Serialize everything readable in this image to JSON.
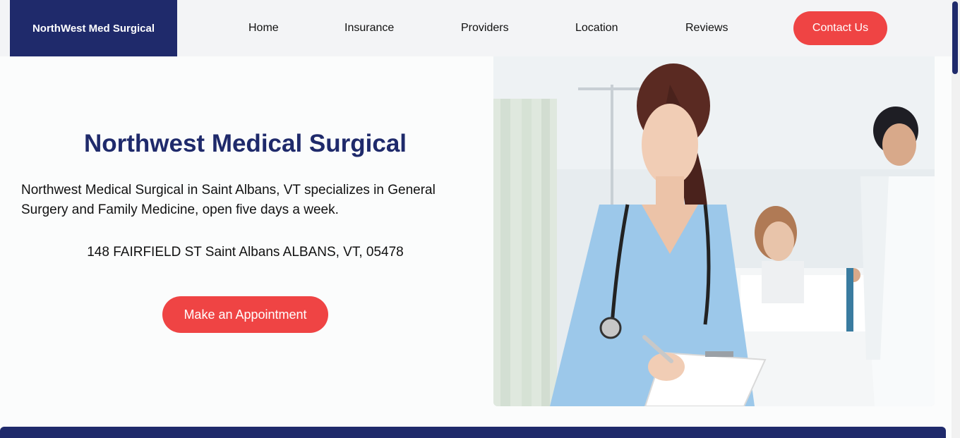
{
  "navbar": {
    "brand": "NorthWest Med Surgical",
    "links": [
      "Home",
      "Insurance",
      "Providers",
      "Location",
      "Reviews"
    ],
    "contact_label": "Contact Us"
  },
  "hero": {
    "title": "Northwest Medical Surgical",
    "description": "Northwest Medical Surgical in Saint Albans, VT specializes in General Surgery and Family Medicine, open five days a week.",
    "address": "148 FAIRFIELD ST Saint Albans ALBANS, VT, 05478",
    "cta_label": "Make an Appointment"
  },
  "colors": {
    "brand_navy": "#1f2a6b",
    "accent_red": "#ef4444",
    "nav_background": "#f3f4f6"
  }
}
